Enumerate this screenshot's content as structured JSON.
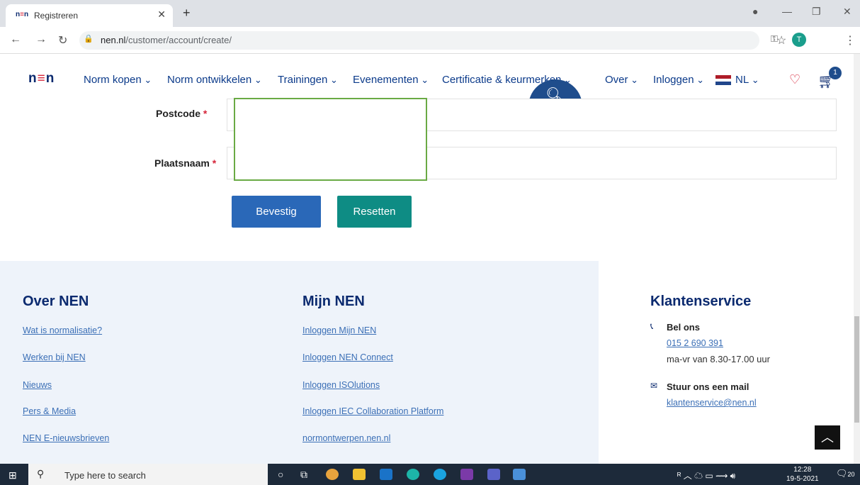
{
  "browser": {
    "tab_title": "Registreren",
    "tab_favicon": "nen",
    "url_domain": "nen.nl",
    "url_path": "/customer/account/create/",
    "profile_initial": "T"
  },
  "nav": {
    "logo": "nen",
    "items": [
      "Norm kopen",
      "Norm ontwikkelen",
      "Trainingen",
      "Evenementen",
      "Certificatie & keurmerken",
      "Over",
      "Inloggen"
    ],
    "language": "NL",
    "cart_count": "1",
    "accent": "#0b2a6f",
    "brand_red": "#d6263a"
  },
  "form": {
    "postcode_label": "Postcode",
    "plaatsnaam_label": "Plaatsnaam",
    "required_mark": "*",
    "confirm_label": "Bevestig",
    "reset_label": "Resetten"
  },
  "footer": {
    "col1": {
      "heading": "Over NEN",
      "links": [
        "Wat is normalisatie?",
        "Werken bij NEN",
        "Nieuws",
        "Pers & Media",
        "NEN E-nieuwsbrieven"
      ]
    },
    "col2": {
      "heading": "Mijn NEN",
      "links": [
        "Inloggen Mijn NEN",
        "Inloggen NEN Connect",
        "Inloggen ISOlutions",
        "Inloggen IEC Collaboration Platform",
        "normontwerpen.nen.nl"
      ]
    },
    "col3": {
      "heading": "Klantenservice",
      "call_label": "Bel ons",
      "phone": "015 2 690 391",
      "hours": "ma-vr van 8.30-17.00 uur",
      "mail_label": "Stuur ons een mail",
      "email": "klantenservice@nen.nl"
    }
  },
  "taskbar": {
    "search_placeholder": "Type here to search",
    "time": "12:28",
    "date": "19-5-2021",
    "notifications": "20"
  }
}
